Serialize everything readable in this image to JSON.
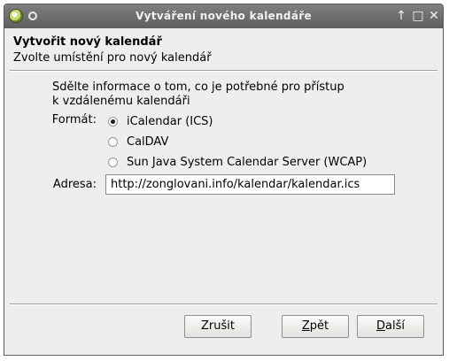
{
  "window": {
    "title": "Vytváření nového kalendáře",
    "controls": {
      "up": "↑",
      "restore": "□",
      "close": "✕"
    }
  },
  "header": {
    "title": "Vytvořit nový kalendář",
    "subtitle": "Zvolte umístění pro nový kalendář"
  },
  "form": {
    "intro": "Sdělte informace o tom, co je potřebné pro přístup k vzdálenému kalendáři",
    "format_label": "Formát:",
    "format_options": [
      {
        "label": "iCalendar (ICS)",
        "selected": true
      },
      {
        "label": "CalDAV",
        "selected": false
      },
      {
        "label": "Sun Java System Calendar Server (WCAP)",
        "selected": false
      }
    ],
    "address_label": "Adresa:",
    "address_value": "http://zonglovani.info/kalendar/kalendar.ics"
  },
  "buttons": {
    "cancel": "Zrušit",
    "back_first": "Z",
    "back_rest": "pět",
    "next_first": "D",
    "next_rest": "alší"
  }
}
